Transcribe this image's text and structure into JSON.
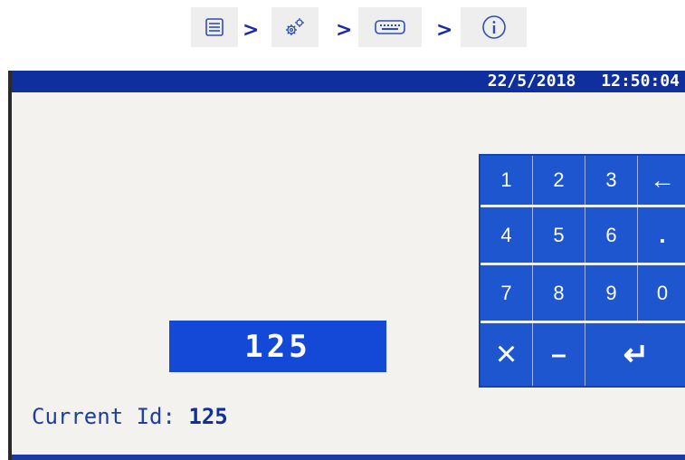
{
  "breadcrumb": {
    "items": [
      {
        "icon": "list-icon"
      },
      {
        "icon": "gears-icon"
      },
      {
        "icon": "keyboard-icon"
      },
      {
        "icon": "info-icon"
      }
    ],
    "separator": ">"
  },
  "status_bar": {
    "date": "22/5/2018",
    "time": "12:50:04"
  },
  "display": {
    "value": "125"
  },
  "current_id": {
    "label": "Current Id:",
    "value": "125"
  },
  "keypad": {
    "row1": [
      "1",
      "2",
      "3",
      "←"
    ],
    "row2": [
      "4",
      "5",
      "6",
      "."
    ],
    "row3": [
      "7",
      "8",
      "9",
      "0"
    ],
    "row4": [
      "×",
      "–",
      "↵"
    ]
  },
  "colors": {
    "status_bar": "#0f2f9e",
    "keypad": "#1e56cf",
    "display": "#1448d6",
    "screen_bg": "#f3f2ee"
  }
}
